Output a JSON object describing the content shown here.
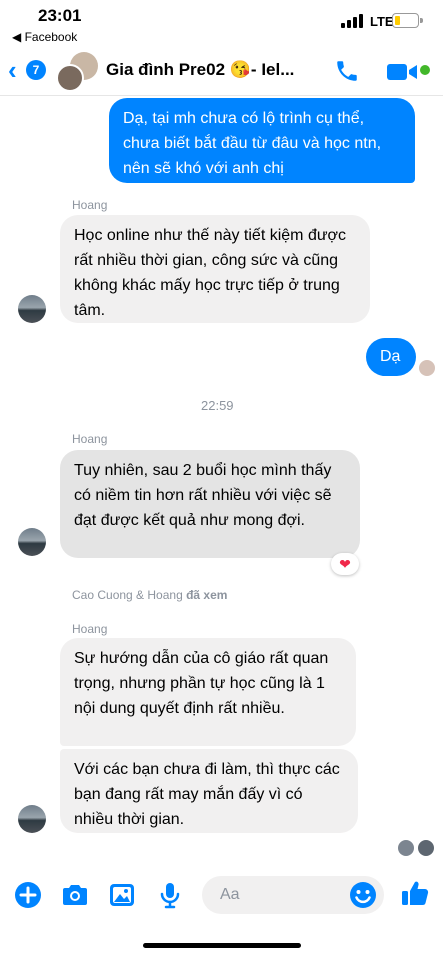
{
  "status_bar": {
    "time": "23:01",
    "back_app": "◀ Facebook",
    "network": "LTE"
  },
  "header": {
    "unread_count": "7",
    "title": "Gia đình Pre02 😘- Iel..."
  },
  "messages": {
    "m1": "Dạ, tại mh chưa có lộ trình cụ thể, chưa biết bắt đầu từ đâu và học ntn, nên sẽ khó với anh chị",
    "sender1": "Hoang",
    "m2": "Học online như thế này tiết kiệm được rất nhiều thời gian, công sức và cũng không khác mấy học trực tiếp ở trung tâm.",
    "m3": "Dạ",
    "timestamp": "22:59",
    "sender2": "Hoang",
    "m4": "Tuy nhiên, sau 2 buổi học mình thấy có niềm tin hơn rất nhiều với việc sẽ đạt được kết quả như mong đợi.",
    "reaction": "❤",
    "seen_names": "Cao Cuong & Hoang",
    "seen_label": "đã xem",
    "sender3": "Hoang",
    "m5": "Sự hướng dẫn của cô giáo rất quan trọng, nhưng phần tự học cũng là 1 nội dung quyết định rất nhiều.",
    "m6": "Với các bạn chưa đi làm, thì thực các bạn đang rất may mắn đấy vì có nhiều thời gian."
  },
  "composer": {
    "placeholder": "Aa"
  },
  "colors": {
    "accent": "#0084ff",
    "incoming_bg": "#f1f0f0",
    "online": "#42b72a"
  },
  "icons": [
    "plus-icon",
    "camera-icon",
    "image-icon",
    "microphone-icon",
    "emoji-icon",
    "thumbs-up-icon",
    "phone-icon",
    "video-icon"
  ]
}
